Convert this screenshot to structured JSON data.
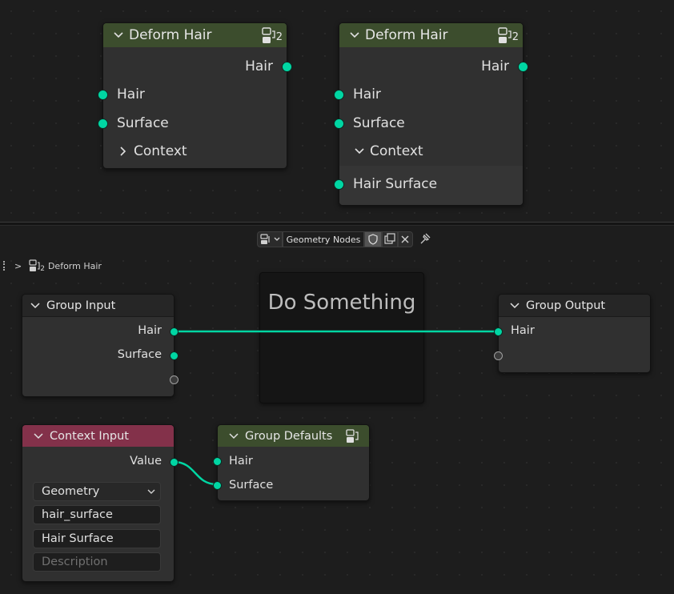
{
  "top_nodes": [
    {
      "title": "Deform Hair",
      "user_count": "2",
      "outputs": [
        "Hair"
      ],
      "inputs": [
        "Hair",
        "Surface"
      ],
      "panel": {
        "label": "Context",
        "expanded": false,
        "inputs": []
      }
    },
    {
      "title": "Deform Hair",
      "user_count": "2",
      "outputs": [
        "Hair"
      ],
      "inputs": [
        "Hair",
        "Surface"
      ],
      "panel": {
        "label": "Context",
        "expanded": true,
        "inputs": [
          "Hair Surface"
        ]
      }
    }
  ],
  "header": {
    "tree_name": "Geometry Nodes",
    "breadcrumb": {
      "separator": ">",
      "group_name": "Deform Hair",
      "group_users": "2"
    }
  },
  "frame": {
    "label": "Do Something"
  },
  "group_input": {
    "title": "Group Input",
    "outputs": [
      "Hair",
      "Surface"
    ]
  },
  "group_output": {
    "title": "Group Output",
    "inputs": [
      "Hair"
    ]
  },
  "context_input": {
    "title": "Context Input",
    "output": "Value",
    "type_select": "Geometry",
    "identifier": "hair_surface",
    "name": "Hair Surface",
    "description_placeholder": "Description"
  },
  "group_defaults": {
    "title": "Group Defaults",
    "inputs": [
      "Hair",
      "Surface"
    ]
  },
  "colors": {
    "geometry_socket": "#00d6a3",
    "group_header": "#3c4d2d",
    "input_header": "#83314a",
    "link": "#00d6a3"
  }
}
